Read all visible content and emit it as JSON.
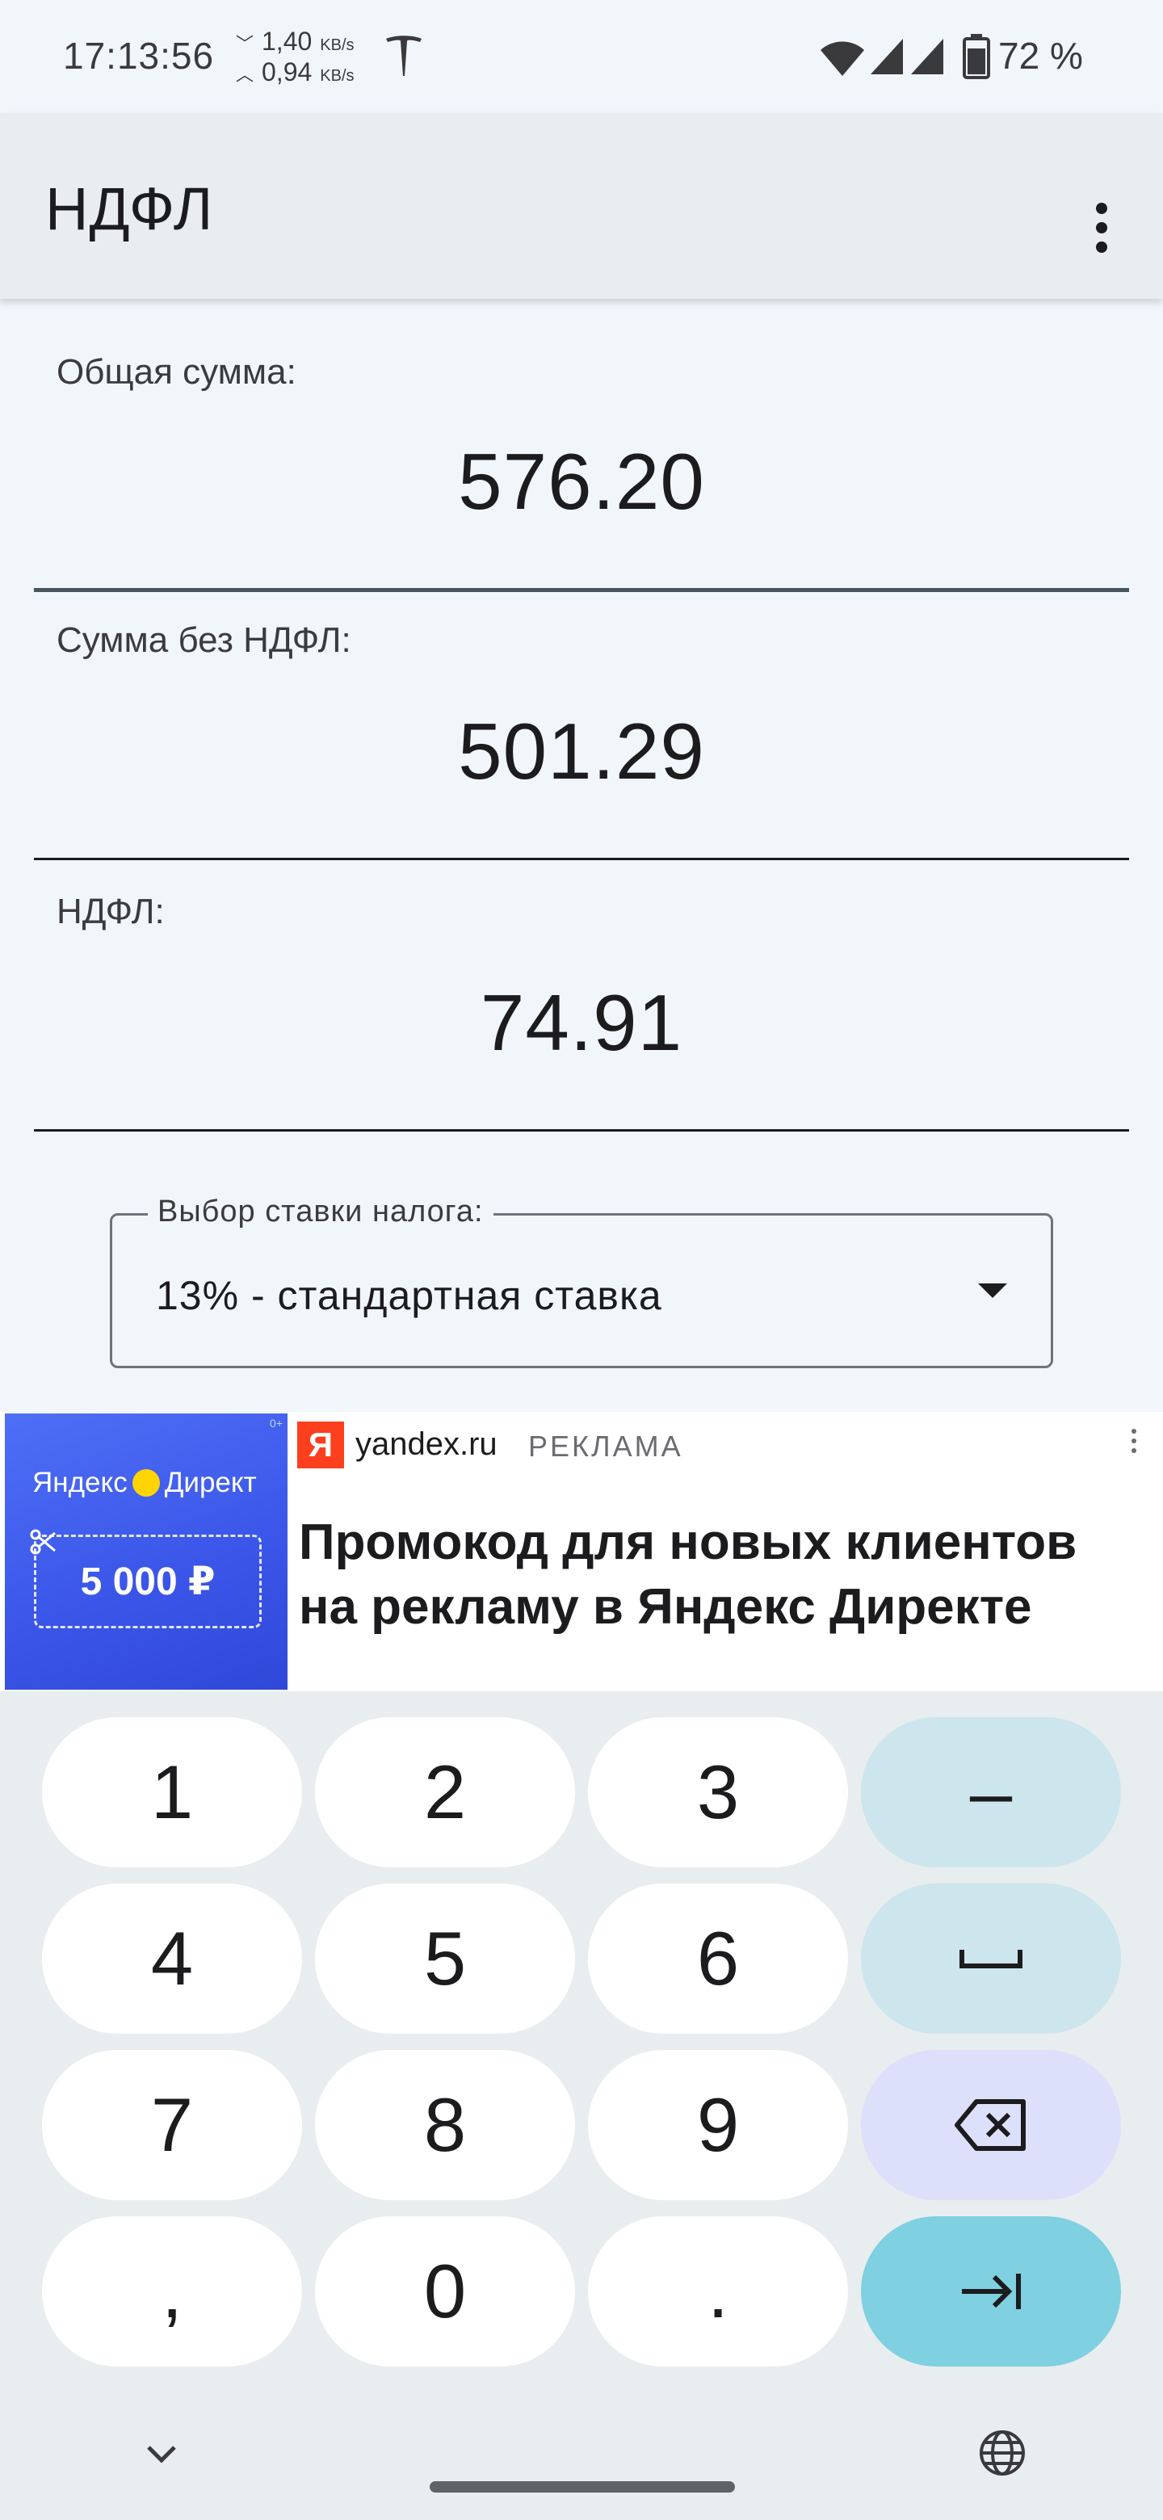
{
  "status_bar": {
    "time": "17:13:56",
    "download_speed": "1,40",
    "upload_speed": "0,94",
    "speed_unit": "KB/s",
    "battery": "72 %"
  },
  "app_bar": {
    "title": "НДФЛ"
  },
  "fields": {
    "total": {
      "label": "Общая сумма:",
      "value": "576.20"
    },
    "net": {
      "label": "Сумма без НДФЛ:",
      "value": "501.29"
    },
    "tax": {
      "label": "НДФЛ:",
      "value": "74.91"
    }
  },
  "rate_select": {
    "legend": "Выбор ставки налога:",
    "selected": "13% - стандартная ставка"
  },
  "ad": {
    "brand": "Яндекс",
    "brand_product": "Директ",
    "coupon": "5 000 ₽",
    "logo_letter": "Я",
    "domain": "yandex.ru",
    "label": "РЕКЛАМА",
    "headline": "Промокод для новых клиентов на рекламу в Яндекс Директе",
    "corner_mark": "0+"
  },
  "keypad": {
    "keys": [
      "1",
      "2",
      "3",
      "4",
      "5",
      "6",
      "7",
      "8",
      "9",
      ",",
      "0",
      "."
    ],
    "minus": "–"
  },
  "colors": {
    "background": "#f1f6fb",
    "app_bar": "#e9edf0",
    "ad_blue": "#3a55e8",
    "yandex_red": "#fc3f1d",
    "key_fn": "#cde5ec",
    "key_delete": "#dde0fb",
    "key_go": "#7fd0e0"
  }
}
